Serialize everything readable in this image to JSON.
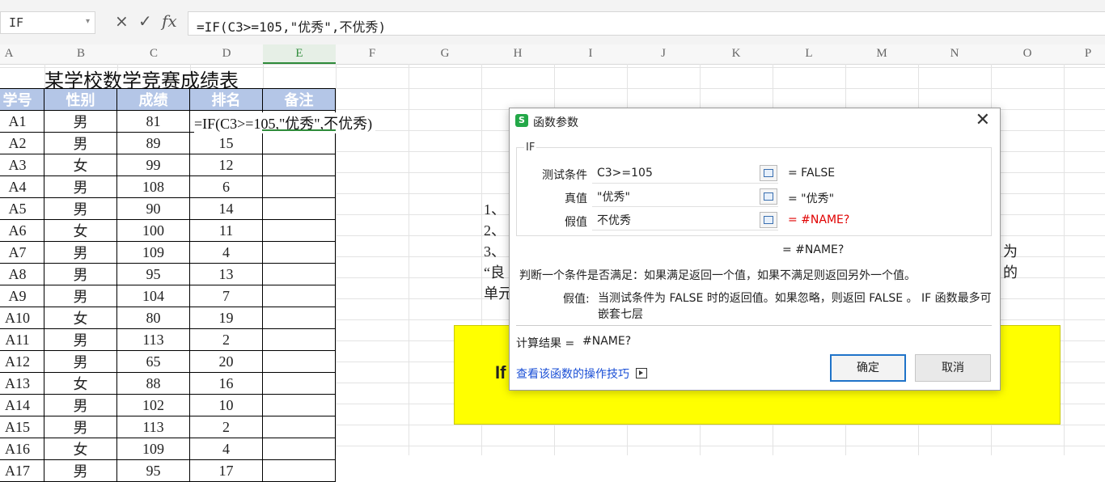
{
  "namebox": {
    "value": "IF"
  },
  "formula_bar": {
    "fx_label": "fx",
    "cancel": "×",
    "confirm": "✓",
    "formula": "=IF(C3>=105,\"优秀\",不优秀)"
  },
  "columns": [
    "A",
    "B",
    "C",
    "D",
    "E",
    "F",
    "G",
    "H",
    "I",
    "J",
    "K",
    "L",
    "M",
    "N",
    "O",
    "P"
  ],
  "sheet": {
    "title": "某学校数学竞赛成绩表",
    "headers": [
      "学号",
      "性别",
      "成绩",
      "排名",
      "备注"
    ],
    "rows": [
      [
        "A1",
        "男",
        "81",
        "",
        ""
      ],
      [
        "A2",
        "男",
        "89",
        "15",
        ""
      ],
      [
        "A3",
        "女",
        "99",
        "12",
        ""
      ],
      [
        "A4",
        "男",
        "108",
        "6",
        ""
      ],
      [
        "A5",
        "男",
        "90",
        "14",
        ""
      ],
      [
        "A6",
        "女",
        "100",
        "11",
        ""
      ],
      [
        "A7",
        "男",
        "109",
        "4",
        ""
      ],
      [
        "A8",
        "男",
        "95",
        "13",
        ""
      ],
      [
        "A9",
        "男",
        "104",
        "7",
        ""
      ],
      [
        "A10",
        "女",
        "80",
        "19",
        ""
      ],
      [
        "A11",
        "男",
        "113",
        "2",
        ""
      ],
      [
        "A12",
        "男",
        "65",
        "20",
        ""
      ],
      [
        "A13",
        "女",
        "88",
        "16",
        ""
      ],
      [
        "A14",
        "男",
        "102",
        "10",
        ""
      ],
      [
        "A15",
        "男",
        "113",
        "2",
        ""
      ],
      [
        "A16",
        "女",
        "109",
        "4",
        ""
      ],
      [
        "A17",
        "男",
        "95",
        "17",
        ""
      ]
    ],
    "cell_formula": "=IF(C3>=105,\"优秀\",不优秀)"
  },
  "background_text": {
    "line1": "1、",
    "line2": "2、",
    "line3": "3、",
    "line4": "“良",
    "line5": "单元",
    "right1": "为",
    "right2": "的",
    "yellow_box": "If"
  },
  "dialog": {
    "title": "函数参数",
    "logo": "S",
    "function_name": "IF",
    "params": [
      {
        "label": "测试条件",
        "value": "C3>=105",
        "result": "= FALSE",
        "error": false
      },
      {
        "label": "真值",
        "value": "\"优秀\"",
        "result": "= \"优秀\"",
        "error": false
      },
      {
        "label": "假值",
        "value": "不优秀",
        "result": "= #NAME?",
        "error": true
      }
    ],
    "overall_result": "= #NAME?",
    "description": "判断一个条件是否满足：如果满足返回一个值，如果不满足则返回另外一个值。",
    "param_desc_label": "假值:",
    "param_desc": "当测试条件为 FALSE 时的返回值。如果忽略，则返回 FALSE 。 IF 函数最多可嵌套七层",
    "calc_label": "计算结果 =",
    "calc_value": "#NAME?",
    "link": "查看该函数的操作技巧",
    "ok": "确定",
    "cancel": "取消"
  },
  "colors": {
    "header_fill": "#b4c6e7",
    "active_green": "#2e8b3a",
    "highlight": "#ffff00",
    "error": "#e00000",
    "link": "#1a4fd6"
  }
}
